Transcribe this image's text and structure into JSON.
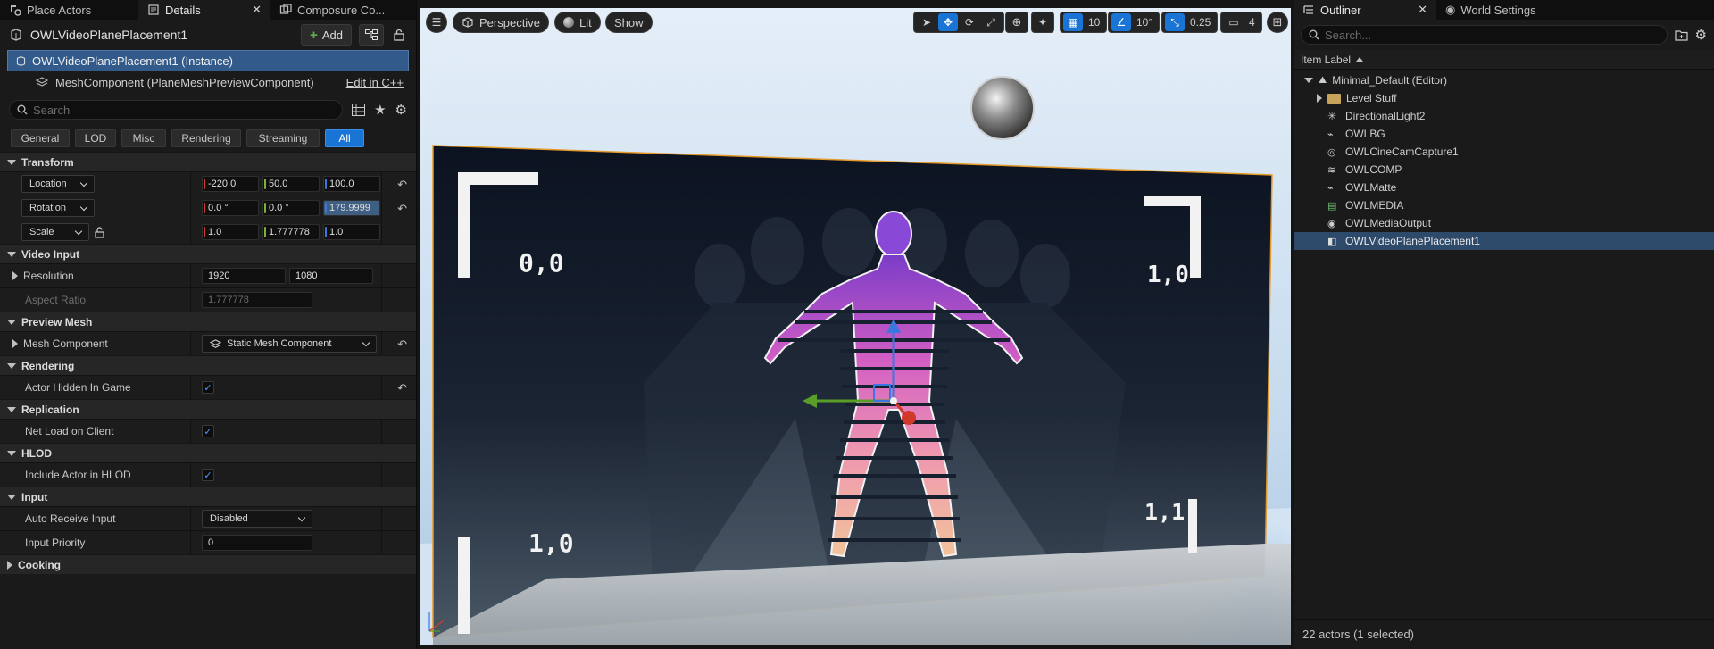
{
  "left_tabs": [
    {
      "label": "Place Actors"
    },
    {
      "label": "Details"
    },
    {
      "label": "Composure Co..."
    }
  ],
  "details": {
    "actor_name": "OWLVideoPlanePlacement1",
    "add_label": "Add",
    "instance_label": "OWLVideoPlanePlacement1 (Instance)",
    "component_label": "MeshComponent (PlaneMeshPreviewComponent)",
    "edit_cpp": "Edit in C++",
    "search_placeholder": "Search",
    "filters": [
      "General",
      "LOD",
      "Misc",
      "Rendering",
      "Streaming",
      "All"
    ],
    "active_filter": "All"
  },
  "sections": {
    "transform": {
      "title": "Transform",
      "location": {
        "label": "Location",
        "x": "-220.0",
        "y": "50.0",
        "z": "100.0"
      },
      "rotation": {
        "label": "Rotation",
        "x": "0.0 °",
        "y": "0.0 °",
        "z": "179.9999"
      },
      "scale": {
        "label": "Scale",
        "x": "1.0",
        "y": "1.777778",
        "z": "1.0"
      }
    },
    "video_input": {
      "title": "Video Input",
      "resolution_label": "Resolution",
      "res_w": "1920",
      "res_h": "1080",
      "aspect_label": "Aspect Ratio",
      "aspect_value": "1.777778"
    },
    "preview_mesh": {
      "title": "Preview Mesh",
      "mesh_label": "Mesh Component",
      "mesh_value": "Static Mesh Component"
    },
    "rendering": {
      "title": "Rendering",
      "hidden_label": "Actor Hidden In Game"
    },
    "replication": {
      "title": "Replication",
      "net_label": "Net Load on Client"
    },
    "hlod": {
      "title": "HLOD",
      "include_label": "Include Actor in HLOD"
    },
    "input": {
      "title": "Input",
      "auto_label": "Auto Receive Input",
      "auto_value": "Disabled",
      "priority_label": "Input Priority",
      "priority_value": "0"
    },
    "cooking": {
      "title": "Cooking"
    }
  },
  "viewport": {
    "perspective": "Perspective",
    "lit": "Lit",
    "show": "Show",
    "grid_snap": "10",
    "rot_snap": "10°",
    "scale_snap": "0.25",
    "cam_speed": "4",
    "corner_tl": "0,0",
    "corner_tr": "1,0",
    "corner_bl": "1,0",
    "corner_br": "1,1"
  },
  "right_tabs": [
    {
      "label": "Outliner"
    },
    {
      "label": "World Settings"
    }
  ],
  "outliner": {
    "search_placeholder": "Search...",
    "column_label": "Item Label",
    "root": "Minimal_Default (Editor)",
    "items": [
      {
        "label": "Level Stuff",
        "icon": "folder-icon"
      },
      {
        "label": "DirectionalLight2",
        "icon": "light-icon"
      },
      {
        "label": "OWLBG",
        "icon": "owl-icon"
      },
      {
        "label": "OWLCineCamCapture1",
        "icon": "camera-icon"
      },
      {
        "label": "OWLCOMP",
        "icon": "layers-icon"
      },
      {
        "label": "OWLMatte",
        "icon": "matte-icon"
      },
      {
        "label": "OWLMEDIA",
        "icon": "media-icon"
      },
      {
        "label": "OWLMediaOutput",
        "icon": "output-icon"
      },
      {
        "label": "OWLVideoPlanePlacement1",
        "icon": "actor-icon"
      }
    ],
    "selected": "OWLVideoPlanePlacement1",
    "status": "22 actors (1 selected)"
  }
}
